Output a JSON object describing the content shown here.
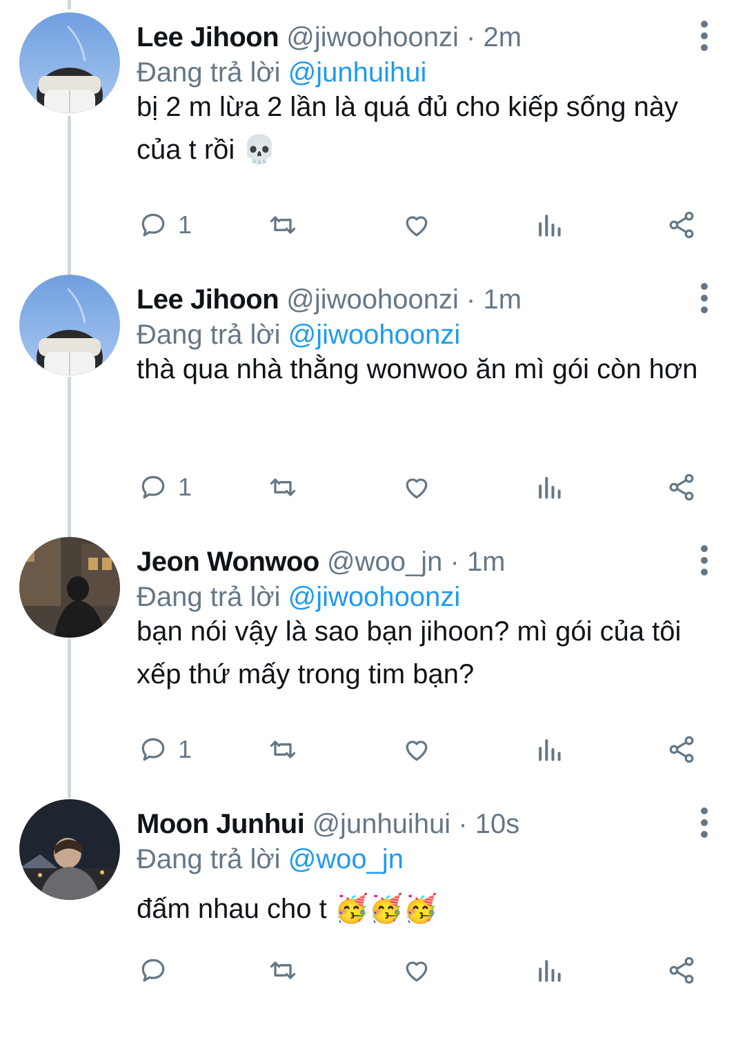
{
  "tweets": [
    {
      "name": "Lee Jihoon",
      "handle": "@jiwoohoonzi",
      "sep": "·",
      "time": "2m",
      "replying_label": "Đang trả lời",
      "replying_to": "@junhuihui",
      "text": "bị 2 m lừa 2 lần là quá đủ cho kiếp sống này của t rồi 💀",
      "reply_count": "1"
    },
    {
      "name": "Lee Jihoon",
      "handle": "@jiwoohoonzi",
      "sep": "·",
      "time": "1m",
      "replying_label": "Đang trả lời",
      "replying_to": "@jiwoohoonzi",
      "text": "thà qua nhà thằng wonwoo ăn mì gói còn hơn",
      "reply_count": "1"
    },
    {
      "name": "Jeon Wonwoo",
      "handle": "@woo_jn",
      "sep": "·",
      "time": "1m",
      "replying_label": "Đang trả lời",
      "replying_to": "@jiwoohoonzi",
      "text": "bạn nói vậy là sao bạn jihoon? mì gói của tôi xếp thứ mấy trong tim bạn?",
      "reply_count": "1"
    },
    {
      "name": "Moon Junhui",
      "handle": "@junhuihui",
      "sep": "·",
      "time": "10s",
      "replying_label": "Đang trả lời",
      "replying_to": "@woo_jn",
      "text": "đấm nhau cho t 🥳🥳🥳",
      "reply_count": ""
    }
  ],
  "icons": {
    "reply": "reply-icon",
    "retweet": "retweet-icon",
    "like": "heart-icon",
    "analytics": "analytics-icon",
    "share": "share-icon",
    "more": "more-vertical-icon"
  },
  "colors": {
    "accent": "#1d9bf0",
    "muted": "#657786",
    "thread_line": "#cfd9de"
  }
}
